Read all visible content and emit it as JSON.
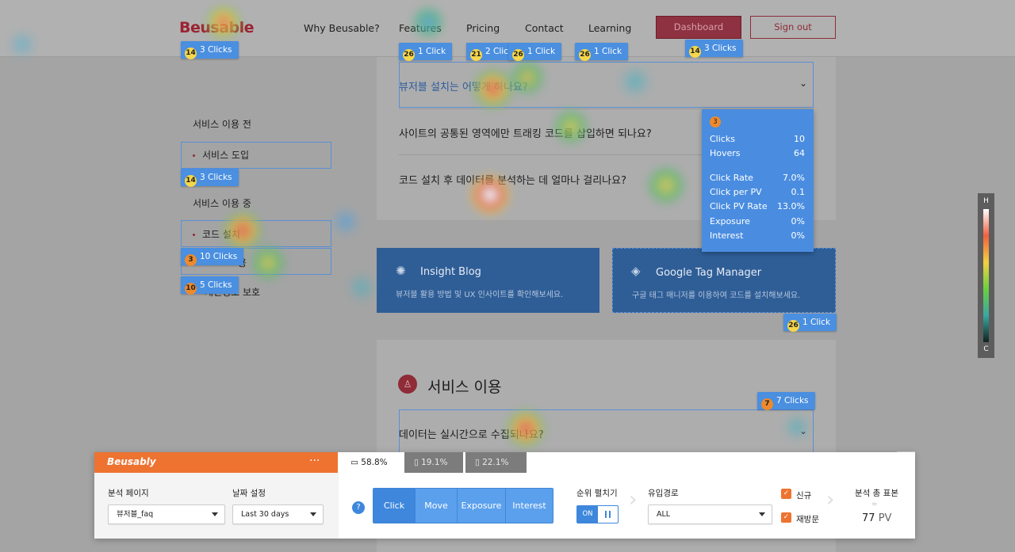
{
  "nav": {
    "logo": "Beusable",
    "links": [
      "Why Beusable?",
      "Features",
      "Pricing",
      "Contact",
      "Learning"
    ],
    "dashboard": "Dashboard",
    "signout": "Sign out"
  },
  "faq": {
    "q1": "뷰저블 설치는 어떻게 하나요?",
    "q2": "사이트의 공통된 영역에만 트래킹 코드를 삽입하면 되나요?",
    "q3": "코드 설치 후 데이터를 분석하는 데 얼마나 걸리나요?"
  },
  "sidebar": {
    "section1": "서비스 이용 전",
    "item1": "서비스 도입",
    "section2": "서비스 이용 중",
    "item2": "코드 설치",
    "item3": "용",
    "item4": "개인정보 보호"
  },
  "cta": {
    "blog_title": "Insight Blog",
    "blog_desc": "뷰저블 활용 방법 및 UX 인사이트를 확인해보세요.",
    "gtm_title": "Google Tag Manager",
    "gtm_desc": "구글 태그 매니저를 이용하여 코드를 설치해보세요."
  },
  "section": {
    "title": "서비스 이용",
    "q1": "데이터는 실시간으로 수집되나요?"
  },
  "badges": [
    {
      "rank": "14",
      "text": "3 Clicks"
    },
    {
      "rank": "26",
      "text": "1 Click"
    },
    {
      "rank": "21",
      "text": "2 Clic"
    },
    {
      "rank": "26",
      "text": "1 Click"
    },
    {
      "rank": "26",
      "text": "1 Click"
    },
    {
      "rank": "14",
      "text": "3 Clicks"
    },
    {
      "rank": "14",
      "text": "3 Clicks"
    },
    {
      "rank": "3",
      "text": "10 Clicks"
    },
    {
      "rank": "10",
      "text": "5 Clicks"
    },
    {
      "rank": "26",
      "text": "1 Click"
    },
    {
      "rank": "7",
      "text": "7 Clicks"
    }
  ],
  "tooltip": {
    "rank": "3",
    "rows": [
      {
        "label": "Clicks",
        "value": "10"
      },
      {
        "label": "Hovers",
        "value": "64"
      },
      {
        "label": "Click Rate",
        "value": "7.0%"
      },
      {
        "label": "Click per PV",
        "value": "0.1"
      },
      {
        "label": "Click PV Rate",
        "value": "13.0%"
      },
      {
        "label": "Exposure",
        "value": "0%"
      },
      {
        "label": "Interest",
        "value": "0%"
      }
    ]
  },
  "legend": {
    "high": "H",
    "low": "C"
  },
  "panel": {
    "brand": "Beusably",
    "menu": "···",
    "page_label": "분석 페이지",
    "page_value": "뷰저블_faq",
    "date_label": "날짜 설정",
    "date_value": "Last 30 days",
    "devices": [
      {
        "label": "58.8%",
        "icon": "desktop-icon"
      },
      {
        "label": "19.1%",
        "icon": "tablet-icon"
      },
      {
        "label": "22.1%",
        "icon": "mobile-icon"
      }
    ],
    "help": "?",
    "modes": [
      "Click",
      "Move",
      "Exposure",
      "Interest"
    ],
    "rank_label": "순위 펼치기",
    "toggle_on": "ON",
    "route_label": "유입경로",
    "route_value": "ALL",
    "new_label": "신규",
    "return_label": "재방문",
    "sample_label": "분석 총 표본",
    "sample_dash": "=",
    "sample_value": "77",
    "sample_unit": "PV"
  },
  "colors": {
    "brand_orange": "#ee7330",
    "accent_blue": "#3e87dd",
    "badge_blue": "#4a8fe0"
  }
}
